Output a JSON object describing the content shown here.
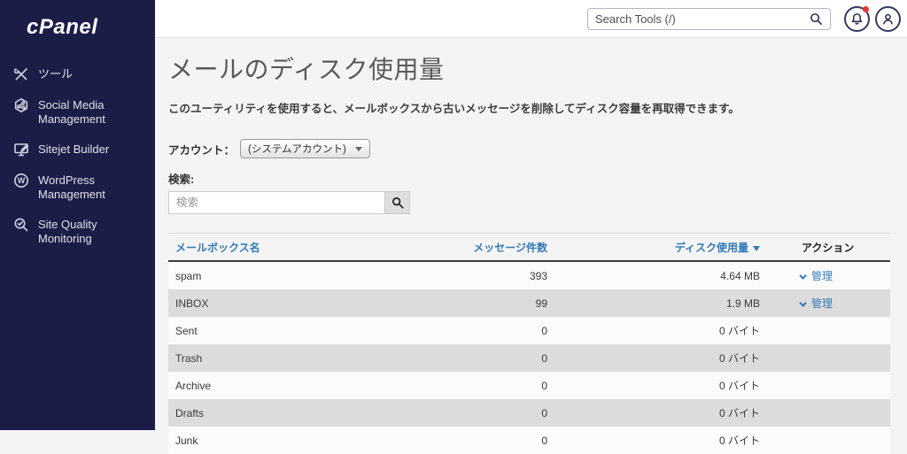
{
  "app": {
    "logo_text": "cPanel"
  },
  "colors": {
    "sidebar_bg": "#1c1d47",
    "link_blue": "#337ab7",
    "notification_red": "#e23b3b",
    "row_stripe_gray": "#dcdcdc"
  },
  "sidebar": {
    "items": [
      {
        "label": "ツール",
        "icon": "tools-icon"
      },
      {
        "label": "Social Media Management",
        "icon": "social-media-icon"
      },
      {
        "label": "Sitejet Builder",
        "icon": "sitejet-builder-icon"
      },
      {
        "label": "WordPress Management",
        "icon": "wordpress-icon"
      },
      {
        "label": "Site Quality Monitoring",
        "icon": "site-quality-icon"
      }
    ]
  },
  "topbar": {
    "search_placeholder": "Search Tools (/)",
    "icons": [
      "search-icon",
      "notification-bell-icon",
      "user-icon"
    ]
  },
  "page": {
    "title": "メールのディスク使用量",
    "description": "このユーティリティを使用すると、メールボックスから古いメッセージを削除してディスク容量を再取得できます。",
    "account_label": "アカウント：",
    "account_value": "(システムアカウント)",
    "search_label": "検索:",
    "search_placeholder": "検索"
  },
  "table": {
    "headers": {
      "mailbox": "メールボックス名",
      "messages": "メッセージ件数",
      "disk_usage": "ディスク使用量",
      "actions": "アクション"
    },
    "sort_column": "disk_usage",
    "sort_direction": "desc",
    "manage_label": "管理",
    "rows": [
      {
        "mailbox": "spam",
        "messages": "393",
        "disk_usage": "4.64 MB",
        "has_manage": true
      },
      {
        "mailbox": "INBOX",
        "messages": "99",
        "disk_usage": "1.9 MB",
        "has_manage": true
      },
      {
        "mailbox": "Sent",
        "messages": "0",
        "disk_usage": "0 バイト",
        "has_manage": false
      },
      {
        "mailbox": "Trash",
        "messages": "0",
        "disk_usage": "0 バイト",
        "has_manage": false
      },
      {
        "mailbox": "Archive",
        "messages": "0",
        "disk_usage": "0 バイト",
        "has_manage": false
      },
      {
        "mailbox": "Drafts",
        "messages": "0",
        "disk_usage": "0 バイト",
        "has_manage": false
      },
      {
        "mailbox": "Junk",
        "messages": "0",
        "disk_usage": "0 バイト",
        "has_manage": false
      }
    ]
  }
}
